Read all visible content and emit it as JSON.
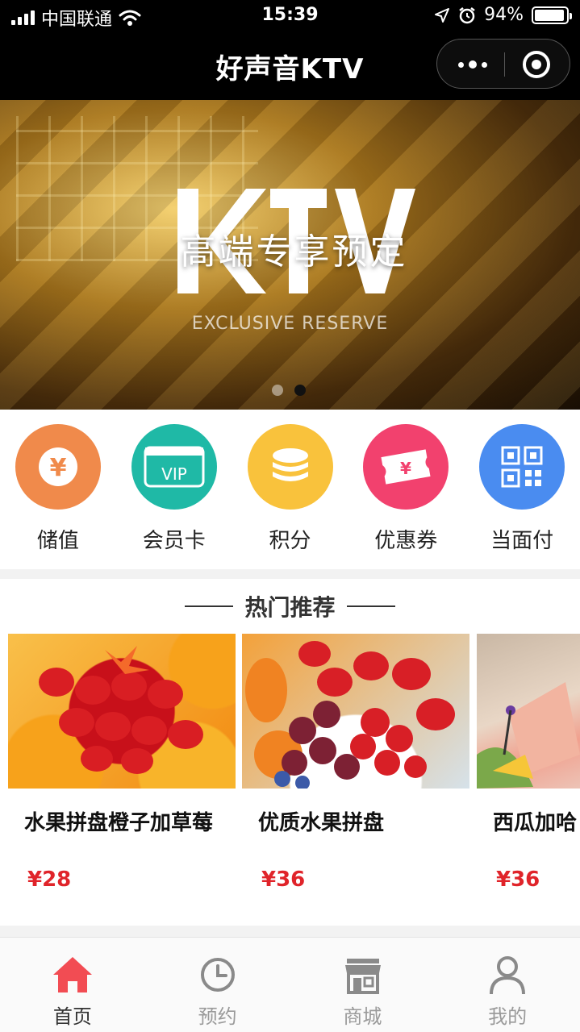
{
  "status_bar": {
    "carrier": "中国联通",
    "time": "15:39",
    "battery": "94%",
    "battery_level": 0.94
  },
  "nav": {
    "title": "好声音KTV"
  },
  "banner": {
    "title": "高端专享预定",
    "subtitle": "EXCLUSIVE  RESERVE",
    "slide_count": 2,
    "active_slide": 2
  },
  "quick_menu": [
    {
      "label": "储值",
      "icon": "yen-coin-icon",
      "color": "#f08a4b"
    },
    {
      "label": "会员卡",
      "icon": "vip-card-icon",
      "color": "#1fb9a6"
    },
    {
      "label": "积分",
      "icon": "coin-stack-icon",
      "color": "#f9c23c"
    },
    {
      "label": "优惠券",
      "icon": "coupon-icon",
      "color": "#f2416e"
    },
    {
      "label": "当面付",
      "icon": "qr-code-icon",
      "color": "#4a8cf0"
    }
  ],
  "hot": {
    "title": "热门推荐",
    "products": [
      {
        "name": "水果拼盘橙子加草莓",
        "price": "¥28"
      },
      {
        "name": "优质水果拼盘",
        "price": "¥36"
      },
      {
        "name": "西瓜加哈",
        "price": "¥36"
      }
    ]
  },
  "tabs": [
    {
      "label": "首页",
      "icon": "home-icon",
      "active": true
    },
    {
      "label": "预约",
      "icon": "clock-icon",
      "active": false
    },
    {
      "label": "商城",
      "icon": "shop-icon",
      "active": false
    },
    {
      "label": "我的",
      "icon": "user-icon",
      "active": false
    }
  ],
  "colors": {
    "accent_red": "#e0242a",
    "tab_active": "#f24c53"
  }
}
